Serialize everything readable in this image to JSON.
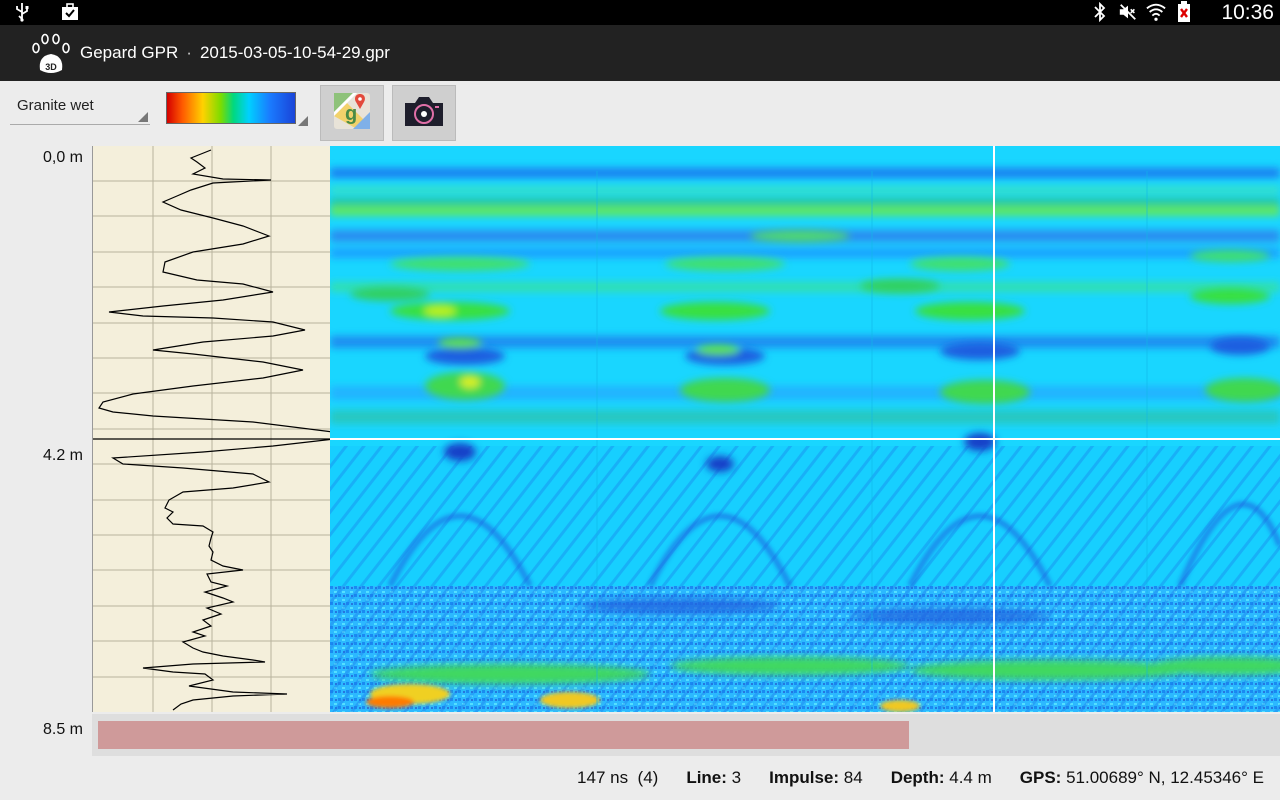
{
  "status_bar": {
    "time": "10:36",
    "left_icons": [
      "usb-icon",
      "clipboard-briefcase-icon"
    ],
    "right_icons": [
      "bluetooth-icon",
      "mute-icon",
      "wifi-icon",
      "battery-icon"
    ]
  },
  "action_bar": {
    "app_name": "Gepard GPR",
    "separator": "·",
    "file_name": "2015-03-05-10-54-29.gpr",
    "app_icon": "paw-3d-icon"
  },
  "toolbar": {
    "material_selected": "Granite wet",
    "colormap": "rainbow-colormap",
    "maps_button_icon": "google-maps-icon",
    "camera_button_icon": "camera-icon"
  },
  "depth_axis": {
    "top": "0,0 m",
    "cursor": "4.2 m",
    "bottom": "8.5 m"
  },
  "scroll": {
    "position_fraction": 0.69
  },
  "info": {
    "time_value": "147 ns",
    "time_index": "(4)",
    "line_label": "Line:",
    "line_value": "3",
    "impulse_label": "Impulse:",
    "impulse_value": "84",
    "depth_label": "Depth:",
    "depth_value": "4.4 m",
    "gps_label": "GPS:",
    "gps_value": "51.00689° N, 12.45346° E"
  },
  "colors": {
    "accent_bar": "#222222",
    "scroll_thumb": "#cf9a9a",
    "trace_background": "#f4efdb",
    "radargram_base": "#18d8ff"
  }
}
